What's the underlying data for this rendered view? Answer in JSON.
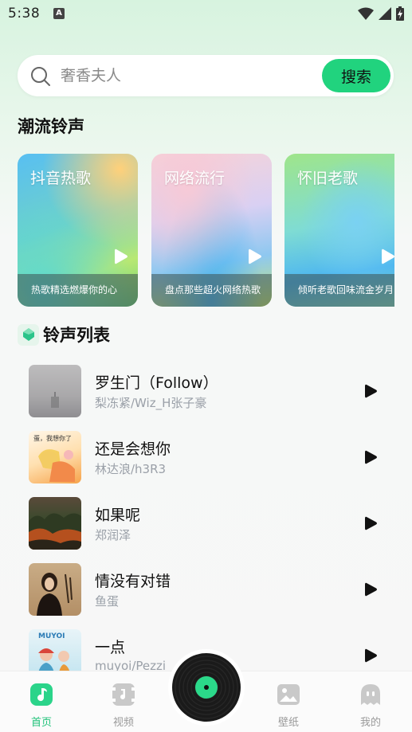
{
  "status_bar": {
    "time": "5:38",
    "notification_badge": "A"
  },
  "search": {
    "placeholder": "奢香夫人",
    "button_label": "搜索"
  },
  "trending": {
    "title": "潮流铃声",
    "cards": [
      {
        "title": "抖音热歌",
        "subtitle": "热歌精选燃爆你的心"
      },
      {
        "title": "网络流行",
        "subtitle": "盘点那些超火网络热歌"
      },
      {
        "title": "怀旧老歌",
        "subtitle": "倾听老歌回味流金岁月"
      }
    ]
  },
  "ringtone_list": {
    "title": "铃声列表",
    "songs": [
      {
        "title": "罗生门（Follow）",
        "artist": "梨冻紧/Wiz_H张子豪"
      },
      {
        "title": "还是会想你",
        "artist": "林达浪/h3R3",
        "cover_text": "蛋，我想你了"
      },
      {
        "title": "如果呢",
        "artist": "郑润泽"
      },
      {
        "title": "情没有对错",
        "artist": "鱼蛋"
      },
      {
        "title": "一点",
        "artist": "muyoi/Pezzi",
        "cover_text": "MUYOI"
      }
    ]
  },
  "tab_bar": {
    "tabs": [
      {
        "label": "首页",
        "icon": "music-note-icon",
        "active": true
      },
      {
        "label": "视频",
        "icon": "video-music-icon",
        "active": false
      },
      {
        "label": "壁纸",
        "icon": "image-icon",
        "active": false
      },
      {
        "label": "我的",
        "icon": "ghost-icon",
        "active": false
      }
    ],
    "center_button": "vinyl-record-icon"
  },
  "colors": {
    "accent": "#21d37e",
    "active_tab": "#21c27a"
  }
}
